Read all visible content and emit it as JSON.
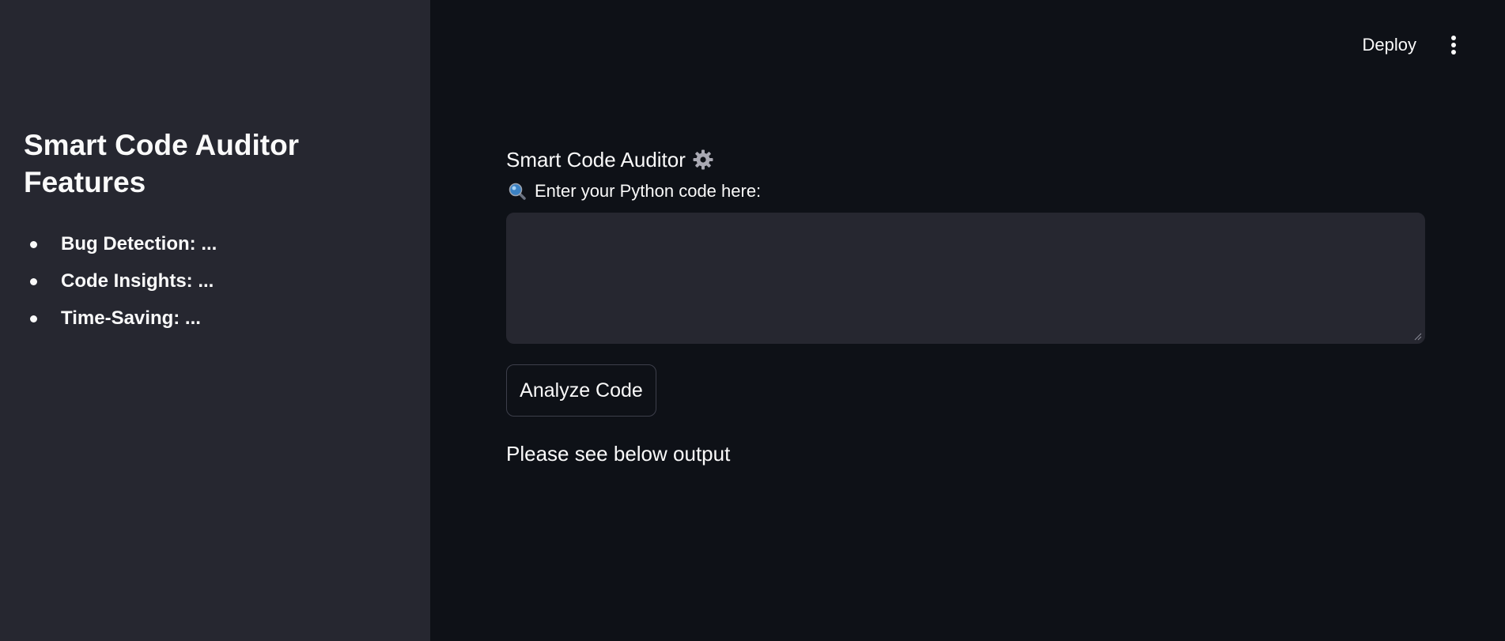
{
  "sidebar": {
    "title": "Smart Code Auditor Features",
    "features": [
      {
        "label": "Bug Detection: ..."
      },
      {
        "label": "Code Insights: ..."
      },
      {
        "label": "Time-Saving: ..."
      }
    ]
  },
  "header": {
    "deploy_label": "Deploy",
    "menu_icon": "vertical-ellipsis-icon"
  },
  "main": {
    "title": "Smart Code Auditor",
    "title_icon": "gear-icon",
    "input_label": "Enter your Python code here:",
    "input_icon": "magnifying-glass-icon",
    "code_value": "",
    "analyze_label": "Analyze Code",
    "output_text": "Please see below output"
  },
  "colors": {
    "background": "#0e1117",
    "sidebar": "#262730",
    "text": "#fafafa",
    "textarea": "#262730",
    "button_border": "#3d3f4b"
  }
}
